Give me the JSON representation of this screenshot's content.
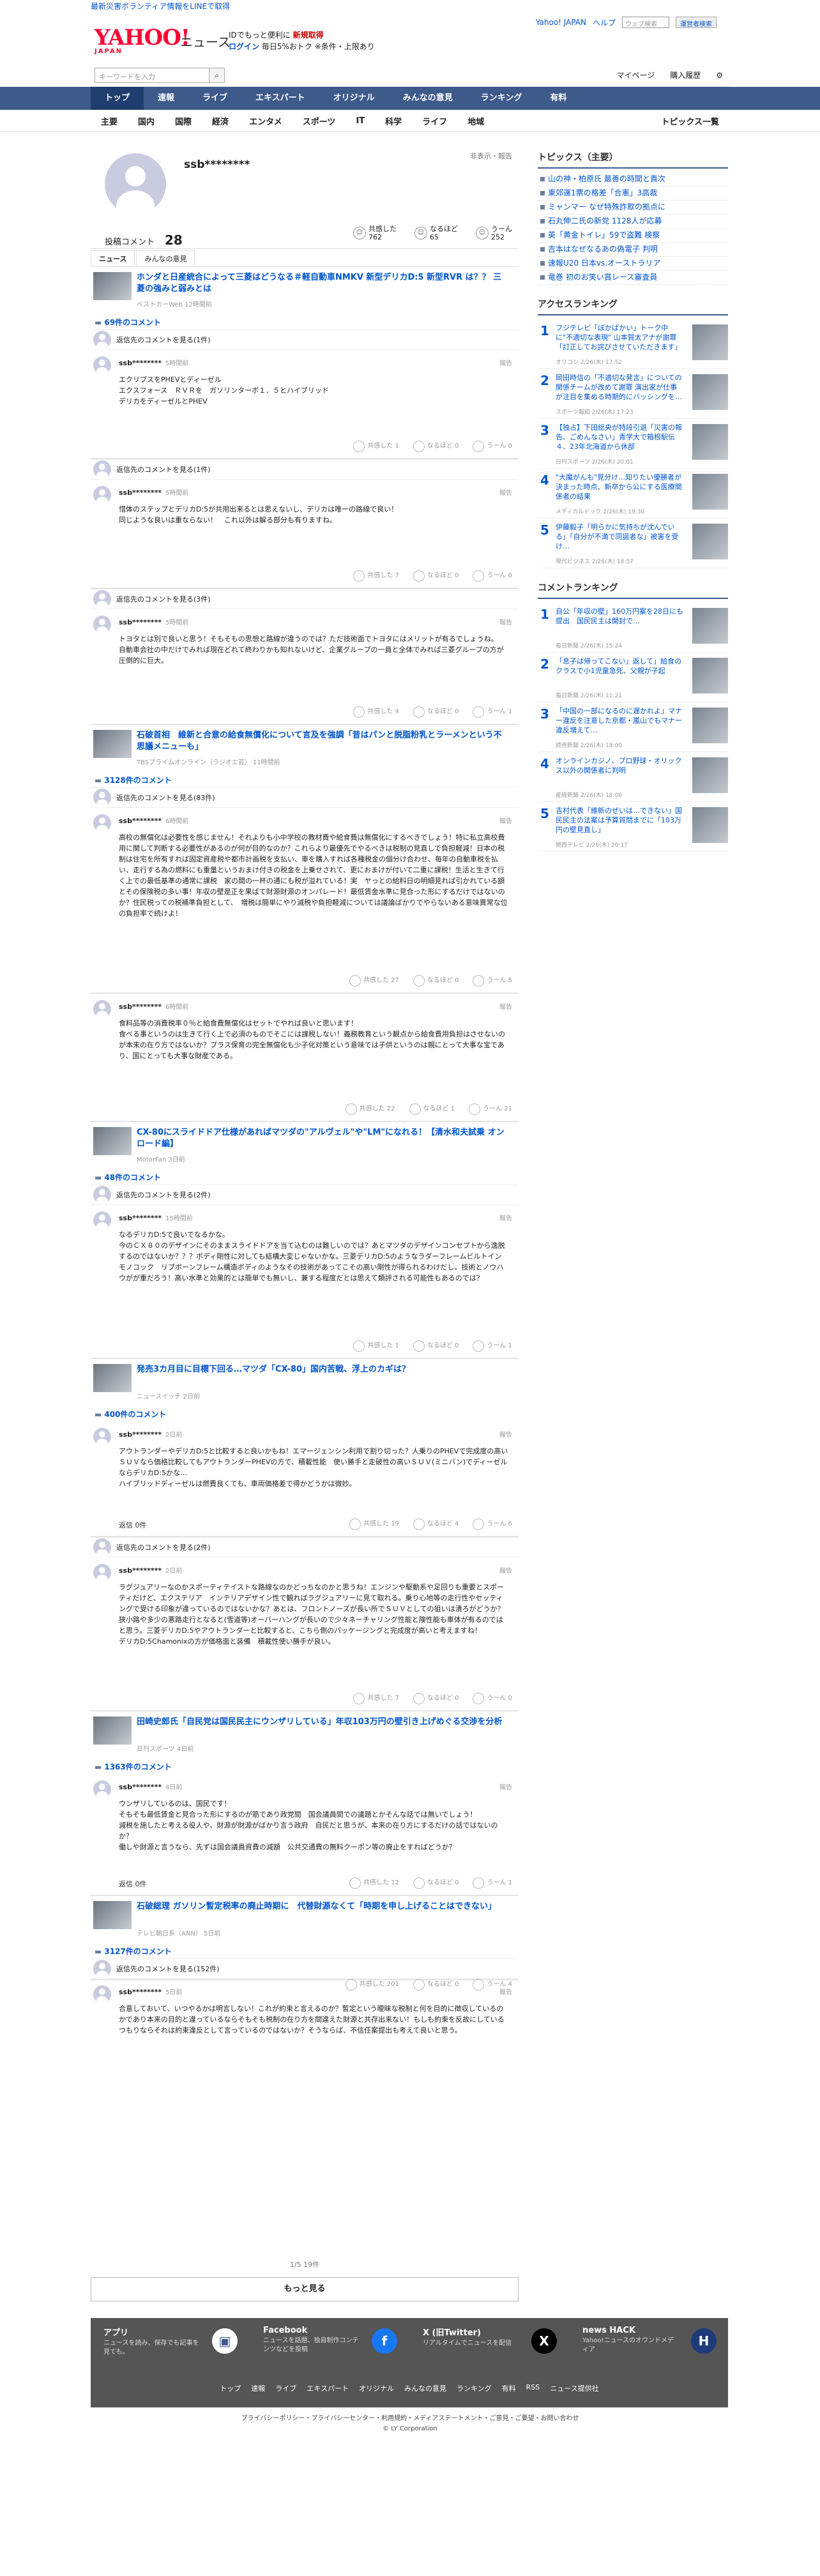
{
  "topbar": {
    "notice": "最新災害ボランティア情報をLINEで取得"
  },
  "header": {
    "logo": "YAHOO!",
    "logo_sub": "JAPAN",
    "brand": "ニュース",
    "promo1": "IDでもっと便利に",
    "promo1b": "新規取得",
    "promo2": "ログイン",
    "promo2b": "毎日5%おトク ※条件・上限あり",
    "yj": "Yahoo! JAPAN",
    "help": "ヘルプ",
    "search_placeholder": "ウェブ検索",
    "search_btn": "運営者検索"
  },
  "subhead": {
    "kw_placeholder": "キーワードを入力",
    "mypage": "マイページ",
    "purchase": "購入履歴"
  },
  "gnav": [
    "トップ",
    "速報",
    "ライブ",
    "エキスパート",
    "オリジナル",
    "みんなの意見",
    "ランキング",
    "有料"
  ],
  "snav": [
    "主要",
    "国内",
    "国際",
    "経済",
    "エンタメ",
    "スポーツ",
    "IT",
    "科学",
    "ライフ",
    "地域"
  ],
  "snav_last": "トピックス一覧",
  "profile": {
    "name": "ssb********",
    "links": "非表示・報告",
    "post_label": "投稿コメント",
    "post_count": "28",
    "stats": [
      {
        "label": "共感した",
        "value": "762"
      },
      {
        "label": "なるほど",
        "value": "65"
      },
      {
        "label": "うーん",
        "value": "252"
      }
    ],
    "tabs": [
      "ニュース",
      "みんなの意見"
    ]
  },
  "blocks": [
    {
      "title": "ホンダと日産統合によって三菱はどうなる＃軽自動車NMKV 新型デリカD:5 新型RVR は？？ 三菱の強みと弱みとは",
      "src": "ベストカーWeb 12時間前",
      "count": "69件のコメント",
      "rep_before": "返信先のコメントを見る(1件)",
      "who": "ssb********",
      "time": "5時間前",
      "report": "報告",
      "body": "エクリプスをPHEVとディーゼル\nエクスフォース　ＲＶＲを　ガソリンターボ１．５とハイブリッド\nデリカをディーゼルとPHEV",
      "r": [
        "共感した 1",
        "なるほど 0",
        "うーん 0"
      ]
    },
    {
      "title": "",
      "src": "",
      "count": "",
      "rep_before": "返信先のコメントを見る(1件)",
      "who": "ssb********",
      "time": "5時間前",
      "report": "報告",
      "body": "惜体のステップとデリカD:5が共用出来るとは思えないし、デリカは唯一の路線で良い！\n同じような良いは重ならない！　これ以外は解る部分も有りますね。",
      "r": [
        "共感した 7",
        "なるほど 0",
        "うーん 0"
      ]
    },
    {
      "title": "",
      "src": "",
      "count": "",
      "rep_before": "返信先のコメントを見る(3件)",
      "who": "ssb********",
      "time": "5時間前",
      "report": "報告",
      "body": "トヨタとは別で良いと思う！そもそもの思想と路線が違うのでは？ただ技術面でトヨタにはメリットが有るでしょうね。\n自動車会社の中だけでみれば現在どれて終わりかも知れないけど、企業グループの一員と全体でみれば三菱グループの方が圧倒的に巨大。",
      "r": [
        "共感した 4",
        "なるほど 0",
        "うーん 1"
      ]
    },
    {
      "title": "石破首相　維新と合意の給食無償化について言及を強調「昔はパンと脱脂粉乳とラーメンという不思議メニューも」",
      "src": "TBSプライムオンライン（ラジオエ芸） 11時間前",
      "count": "3128件のコメント",
      "rep_before": "返信先のコメントを見る(83件)",
      "who": "ssb********",
      "time": "6時間前",
      "report": "報告",
      "body": "高校の無償化は必要性を感じません！それよりも小中学校の教材費や給食費は無償化にするべきでしょう！特に私立高校費用に関して判断する必要性があるのが何が目的なのか？これらより最優先でやるべきは税制の見直しで負担軽減！日本の税制は住宅を所有すれば固定資産税や都市計画税を支払い、車を購入すれば各種税金の個分け合わせ、毎年の自動車税を払い、走行する為の燃料にも重量というおまけ付きの税金を上乗せされて、更におまけが付いて二重に課税！生活と生きて行く上での最低基準の通常に課税　家の間の一杯の通にも税が溢れている！実　ヤっとの給料日の明細見れば引かれている額とその保険税の多い事！年収の壁是正を果ばて財源財源のオンパレード！最低賃金水準に見合った形にするだけではないのか？住民税っての税補準負担として、　増税は簡単にやり減税や負担軽減については議論ばかりでやらないある意味異常な位の負担率で続けよ！",
      "r": [
        "共感した 27",
        "なるほど 0",
        "うーん 5"
      ]
    },
    {
      "title": "",
      "src": "",
      "count": "",
      "rep_before": "",
      "who": "ssb********",
      "time": "6時間前",
      "report": "報告",
      "body": "食料品等の消費税率０％と給食費無償化はセットでやれば良いと思います！\n食べる事というのは生きて行く上で必須のものでそこには課税しない！義務教育という観点から給食費用負担はさせないのが本来の在り方ではないか？プラス保育の完全無償化も少子化対策という意味では子供というのは親にとって大事な宝であり、国にとっても大事な財産である。",
      "r": [
        "共感した 22",
        "なるほど 1",
        "うーん 21"
      ]
    },
    {
      "title": "CX-80にスライドドア仕様があればマツダの\"アルヴェル\"や\"LM\"になれる！【清水和夫試乗 オンロード編】",
      "src": "MotorFan 3日前",
      "count": "48件のコメント",
      "rep_before": "返信先のコメントを見る(2件)",
      "who": "ssb********",
      "time": "15時間前",
      "report": "報告",
      "body": "なるデリカD:5で良いでなるかな。\n今のＣＸ８０のデザインにそのままスライドドアを当て込むのは難しいのでは？あとマツダのデザインコンセプトから逸脱するのではないか？？？ボディ剛性に対しても結構大変じゃないかな。三菱デリカD:5のようなラダーフレームビルトインモノコック　リブボーンフレーム構造ボディのようなその技術があってこその高い剛性が得られるわけだし。技術とノウハウがが重だろう！高い水準と効果的とは簡単でも無いし、兼する程度だとは思えて類評される可能性もあるのでは？",
      "r": [
        "共感した 1",
        "なるほど 0",
        "うーん 1"
      ]
    },
    {
      "title": "発売3カ月目に目標下回る…マツダ「CX-80」国内苦戦、浮上のカギは？",
      "src": "ニュースイッチ 2日前",
      "count": "400件のコメント",
      "rep_before": "",
      "who": "ssb********",
      "time": "2日前",
      "report": "報告",
      "body": "アウトランダーやデリカD:5と比較すると良いかもね！エマージェンシン利用で割り切った？人乗りのPHEVで完成度の高いＳＵＶなら価格比較してもアウトランダーPHEVの方で、積載性能　使い勝手と走破性の高いＳＵＶ(ミニバン)でディーゼルならデリカD:5かな…\nハイブリッドディーゼルは燃費良くても、車両価格差で得かどうかは微妙。",
      "r": [
        "共感した 19",
        "なるほど 4",
        "うーん 6"
      ],
      "reply": "返信 0件"
    },
    {
      "title": "",
      "src": "",
      "count": "",
      "rep_before": "返信先のコメントを見る(2件)",
      "who": "ssb********",
      "time": "2日前",
      "report": "報告",
      "body": "ラグジュアリーなのかスポーティテイストな路線なのかどっちなのかと思うね！エンジンや駆動系や足回りも重要とスポーティだけど、エクステリア　インテリアデザイン性で観ればラグジュアリーに見て取れる。乗り心地等の走行性やセッティングで受ける印象が違っているのではないかな？あとは、フロントノーズが長い所でＳＵＶとしての狙いは潰ろがどうか？狭小路や多少の悪路走行となると(雪道等)オーバーハングが長いので少々ネーチャリング性能と険性能も車体が有るのではと思う。三菱デリカD:5やアウトランダーと比較すると、こちら側のパッケージングと完成度が高いと考えますね！\nデリカD:5Chamonixの方が価格面と装備　積載性使い勝手が良い。",
      "r": [
        "共感した 7",
        "なるほど 0",
        "うーん 0"
      ]
    },
    {
      "title": "田崎史郎氏「自民党は国民民主にウンザリしている」年収103万円の壁引き上げめぐる交渉を分析",
      "src": "日刊スポーツ 4日前",
      "count": "1363件のコメント",
      "rep_before": "",
      "who": "ssb********",
      "time": "4日前",
      "report": "報告",
      "body": "ウンザリしているのは、国民です！\nそもそも最低賃金と見合った形にするのが筋であり政党間　国会議員間での議題とかそんな話では無いでしょう！\n減税を施したと考える役人や、財源が財源がばかり言う政府　自民だと思うが、本来の在り方にするだけの話ではないのか？\n働しや財源と言うなら、先ずは国会議員資費の減額　公共交通費の無料クーポン等の廃止をすればどうか？",
      "r": [
        "共感した 12",
        "なるほど 0",
        "うーん 1"
      ],
      "reply": "返信 0件"
    },
    {
      "title": "石破総理 ガソリン暫定税率の廃止時期に　代替財源なくて「時期を申し上げることはできない」",
      "src": "テレビ朝日系（ANN） 5日前",
      "count": "3127件のコメント",
      "rep_before": "返信先のコメントを見る(152件)",
      "who": "ssb********",
      "time": "5日前",
      "report": "報告",
      "body": "合意しておいて、いつやるかは明言しない！これが約束と言えるのか？暫定という曖昧な税制と何を目的に徴収しているのかであり本来の目的と違っているならそもそも税制の在り方を間違えた財源と共存出来ない！もしも約束を反故にしているつもりならそれは約束違反として言っているのではないか？そうならば、不信任案提出も考えて良いと思う。",
      "r": [
        "共感した 201",
        "なるほど 0",
        "うーん 4"
      ]
    }
  ],
  "more": {
    "page": "1/5 19件",
    "btn": "もっと見る"
  },
  "side": {
    "topics_title": "トピックス（主要）",
    "topics": [
      "山の神・柏原氏 最善の時間と責次",
      "東郊運1票の格差「合憲」3高裁",
      "ミャンマー なぜ特殊詐欺の拠点に",
      "石丸伸二氏の新党 1128人が応募",
      "英「黄金トイレ」59で盗難 検察",
      "吉本はなぜなるあの偽電子 判明",
      "速報U20 日本vs.オーストラリア",
      "竜巻 初のお笑い賞レース審査員"
    ],
    "rank_title": "アクセスランキング",
    "ranks": [
      {
        "n": "1",
        "t": "フジテレビ「ぼかばかい」トーク中に\"不適切な表現\" 山本賀太アナが謝罪「訂正してお詫びさせていただきます」",
        "s": "オリコン 2/26(木) 17:52"
      },
      {
        "n": "2",
        "t": "岡田時信の「不適切な発言」についての関係チームが改めて謝罪 演出家が仕事が注目を集める時期的にバッシングを…",
        "s": "スポーツ報知 2/26(木) 17:23"
      },
      {
        "n": "3",
        "t": "【独占】下田総央が特段引退「災害の報告、ごめんなさい」青学大で箱根駅伝４、23年北海道から休部",
        "s": "日刊スポーツ 2/26(木) 20:01"
      },
      {
        "n": "4",
        "t": "\"大魔がんも\"見分け…知りたい優勝者が決まった時点、新卒から公にする医療関係者の結果",
        "s": "メディカルドック 2/26(木) 19:30"
      },
      {
        "n": "5",
        "t": "伊藤毅子「明らかに気持ちが沈んでいる」「自分が不満で同誕者な」被害を受け…",
        "s": "現代ビジネス 2/26(木) 18:57"
      }
    ],
    "cr_title": "コメントランキング",
    "cranks": [
      {
        "n": "1",
        "t": "自公「年収の壁」160万円案を28日にも提出　国民民主は開封で…",
        "s": "毎日新聞 2/26(木) 15:24"
      },
      {
        "n": "2",
        "t": "「息子は帰ってこない」返して」給食のクラスで小1児童急死、父親が子起",
        "s": "毎日新聞 2/26(木) 11:21"
      },
      {
        "n": "3",
        "t": "「中国の一部になるのに遅かれよ」マナー違反を注意した京都・嵐山でもマナー違反増えて…",
        "s": "読売新聞 2/26(木) 18:00"
      },
      {
        "n": "4",
        "t": "オンラインカジノ、プロ野球・オリックス以外の関係者に判明",
        "s": "産経新聞 2/26(木) 18:06"
      },
      {
        "n": "5",
        "t": "吉村代表「維新のぜいは…できない」国民民主の法案は予算質問までに「103万円の壁見直し」",
        "s": "関西テレビ 2/26(木) 20:17"
      }
    ]
  },
  "footer": {
    "items": [
      {
        "t": "アプリ",
        "d": "ニュースを読み、保存でも記事を見ても。"
      },
      {
        "t": "Facebook",
        "d": "ニュースを話題、独自制作コンテンツなどを投稿"
      },
      {
        "t": "X (旧Twitter)",
        "d": "リアルタイムでニュースを配信"
      },
      {
        "t": "news HACK",
        "d": "Yahoo!ニュースのオウンドメディア"
      }
    ],
    "links": [
      "トップ",
      "速報",
      "ライブ",
      "エキスパート",
      "オリジナル",
      "みんなの意見",
      "ランキング",
      "有料",
      "RSS",
      "ニュース提供社"
    ],
    "policy": "プライバシーポリシー・プライバシーセンター・利用規約・メディアステートメント・ご意見・ご要望・お問い合わせ",
    "corp": "© LY Corporation"
  }
}
